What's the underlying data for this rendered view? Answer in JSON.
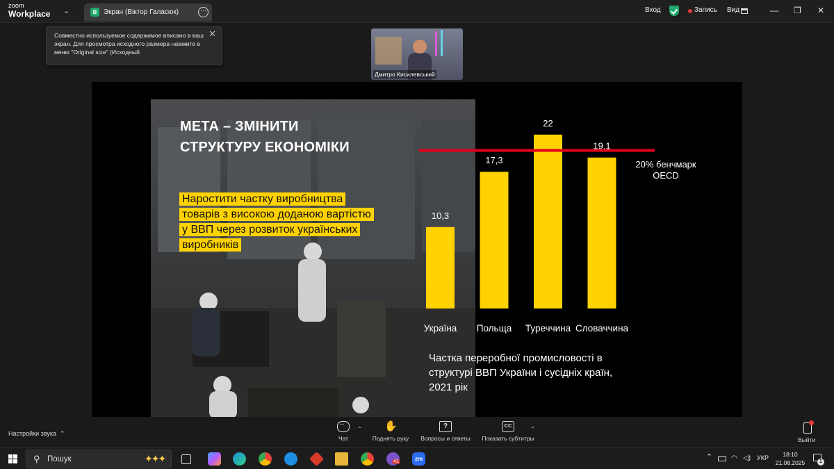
{
  "app": {
    "brand_top": "zoom",
    "brand_bottom": "Workplace"
  },
  "tab": {
    "badge": "В",
    "label": "Экран (Віктор Галасюк)"
  },
  "topbar": {
    "login": "Вход",
    "record": "Запись",
    "view": "Вид",
    "minimize": "—",
    "restore": "❐",
    "close": "✕"
  },
  "notification": {
    "text": "Совместно используемое содержимое вписано в ваш экран. Для просмотра исходного размера нажмите в меню \"Original size\" (Исходный",
    "close": "✕"
  },
  "video": {
    "participant_name": "Дмитро Кисилевський"
  },
  "slide": {
    "title_line1": "МЕТА – ЗМІНИТИ",
    "title_line2": "СТРУКТУРУ ЕКОНОМІКИ",
    "highlight_line1": "Наростити частку виробництва",
    "highlight_line2": "товарів з високою доданою вартістю",
    "highlight_line3": "у ВВП через розвиток українських",
    "highlight_line4": "виробників"
  },
  "chart_data": {
    "type": "bar",
    "categories": [
      "Україна",
      "Польща",
      "Туреччина",
      "Словаччина"
    ],
    "values": [
      10.3,
      17.3,
      22,
      19.1
    ],
    "value_labels": [
      "10,3",
      "17,3",
      "22",
      "19,1"
    ],
    "benchmark": {
      "value": 20,
      "label_line1": "20% бенчмарк",
      "label_line2": "OECD",
      "color": "#e3001b"
    },
    "bar_color": "#ffd200",
    "ylim": [
      0,
      24
    ],
    "caption_line1": "Частка переробної промисловості в",
    "caption_line2": "структурі ВВП України і сусідніх країн,",
    "caption_line3": "2021 рік"
  },
  "toolbar": {
    "audio_settings": "Настройки звука",
    "chat": "Чат",
    "raise_hand": "Поднять руку",
    "qa": "Вопросы и ответы",
    "captions": "Показать субтитры",
    "exit": "Выйти"
  },
  "taskbar": {
    "search_placeholder": "Пошук",
    "language": "УКР",
    "time": "18:10",
    "date": "21.08.2025",
    "viber_badge": "41",
    "notification_badge": "1"
  }
}
